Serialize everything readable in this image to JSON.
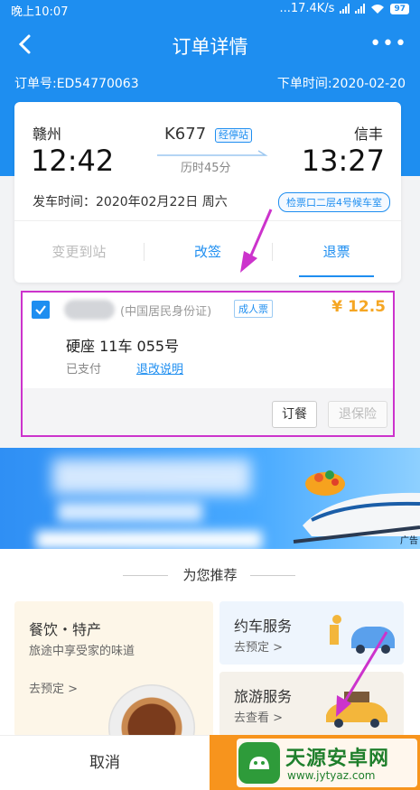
{
  "status_bar": {
    "time": "晚上10:07",
    "speed": "...17.4K/s",
    "battery": "97"
  },
  "nav": {
    "title": "订单详情",
    "more": "•••"
  },
  "order": {
    "number": "订单号:ED54770063",
    "date": "下单时间:2020-02-20"
  },
  "trip": {
    "from_station": "赣州",
    "from_time": "12:42",
    "to_station": "信丰",
    "to_time": "13:27",
    "train_no": "K677",
    "via_label": "经停站",
    "duration": "历时45分",
    "departure": "发车时间：2020年02月22日 周六",
    "gate": "检票口二层4号候车室"
  },
  "actions": [
    "变更到站",
    "改签",
    "退票"
  ],
  "passenger": {
    "id_type": "(中国居民身份证)",
    "ticket_type": "成人票",
    "price": "¥ 12.5",
    "seat": "硬座 11车 055号",
    "status": "已支付",
    "policy_link": "退改说明",
    "meal_button": "订餐",
    "insurance_button": "退保险"
  },
  "banner": {
    "ad_label": "广告"
  },
  "recommend": {
    "title": "为您推荐",
    "food": {
      "title": "餐饮・特产",
      "desc": "旅途中享受家的味道",
      "go": "去预定 >"
    },
    "car": {
      "title": "约车服务",
      "go": "去预定 >"
    },
    "travel": {
      "title": "旅游服务",
      "go": "去查看 >"
    }
  },
  "bottom": {
    "cancel": "取消"
  },
  "watermark": {
    "title": "天源安卓网",
    "url": "www.jytyaz.com"
  },
  "colors": {
    "primary": "#1e8ef0",
    "price": "#f5a623",
    "confirm": "#f7941d",
    "annotation": "#cc33cc"
  }
}
